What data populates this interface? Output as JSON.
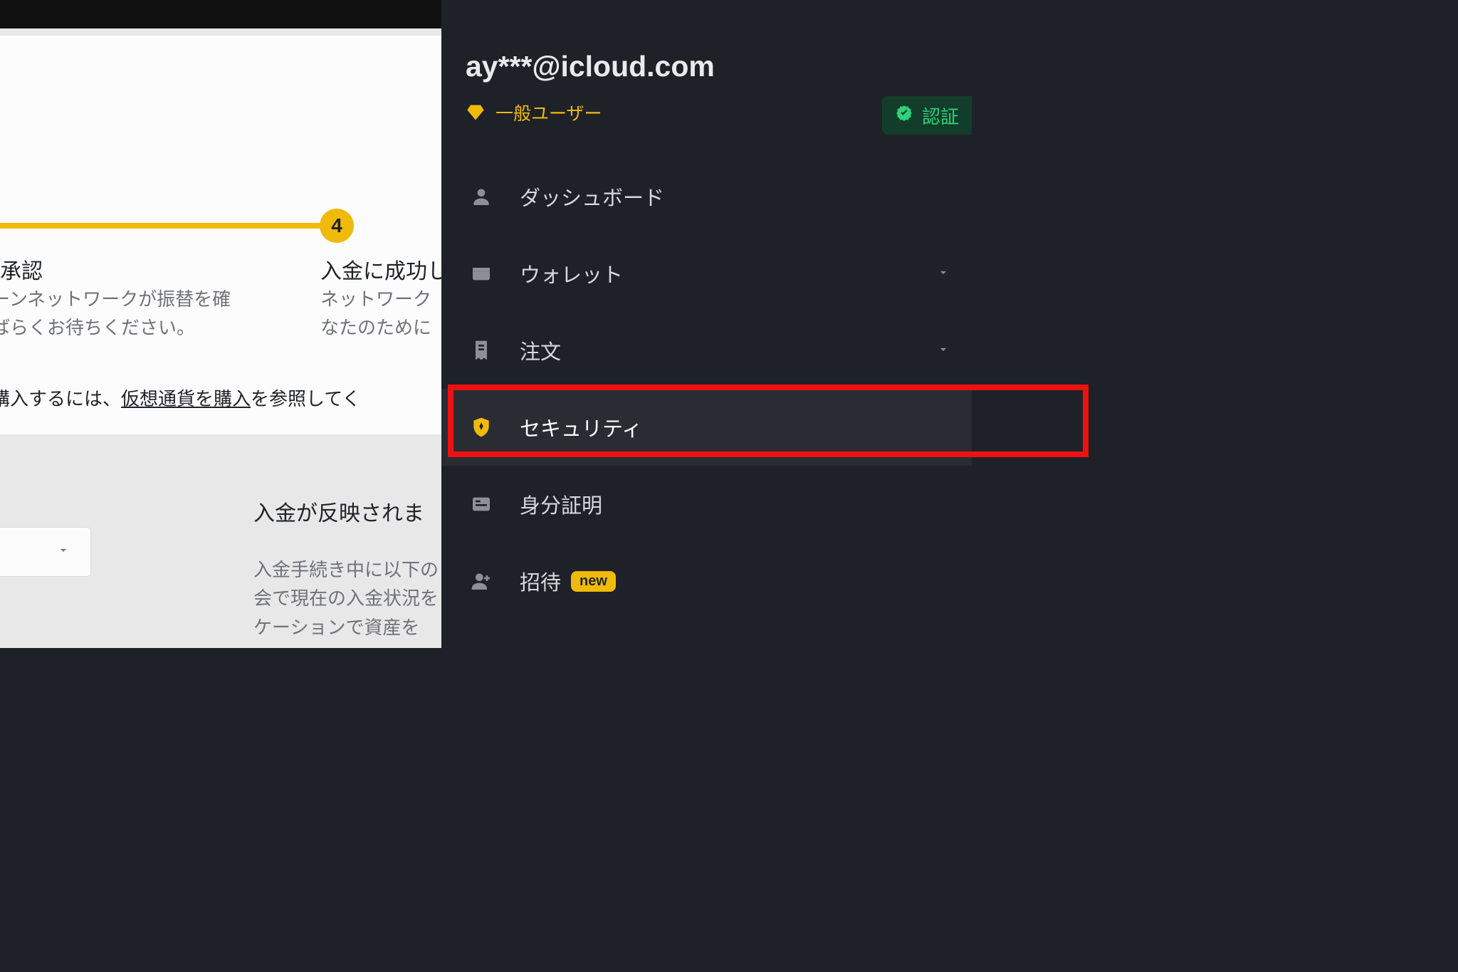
{
  "colors": {
    "accent": "#f0ba0a",
    "dark_bg": "#1f2129",
    "highlight": "#e11"
  },
  "main": {
    "step_number": "4",
    "step3": {
      "title": "ワーク承認",
      "desc_line1": "クチェーンネットワークが振替を確",
      "desc_line2": "までしばらくお待ちください。"
    },
    "step4": {
      "title": "入金に成功し",
      "desc_line1": "ネットワーク",
      "desc_line2": "なたのために"
    },
    "purchase_prefix": "通貨を購入するには、",
    "purchase_link": "仮想通貨を購入",
    "purchase_suffix": "を参照してく",
    "reflect_heading": "入金が反映されま",
    "reflect_body_line1": "入金手続き中に以下の",
    "reflect_body_line2": "会で現在の入金状況を",
    "reflect_body_line3": "ケーションで資産を"
  },
  "account": {
    "email": "ay***@icloud.com",
    "tier_label": "一般ユーザー",
    "verify_label": "認証"
  },
  "sidebar": {
    "items": [
      {
        "id": "dashboard",
        "label": "ダッシュボード",
        "expandable": false
      },
      {
        "id": "wallet",
        "label": "ウォレット",
        "expandable": true
      },
      {
        "id": "orders",
        "label": "注文",
        "expandable": true
      },
      {
        "id": "security",
        "label": "セキュリティ",
        "expandable": false,
        "active": true
      },
      {
        "id": "identity",
        "label": "身分証明",
        "expandable": false
      },
      {
        "id": "invite",
        "label": "招待",
        "expandable": false,
        "badge": "new"
      }
    ]
  }
}
